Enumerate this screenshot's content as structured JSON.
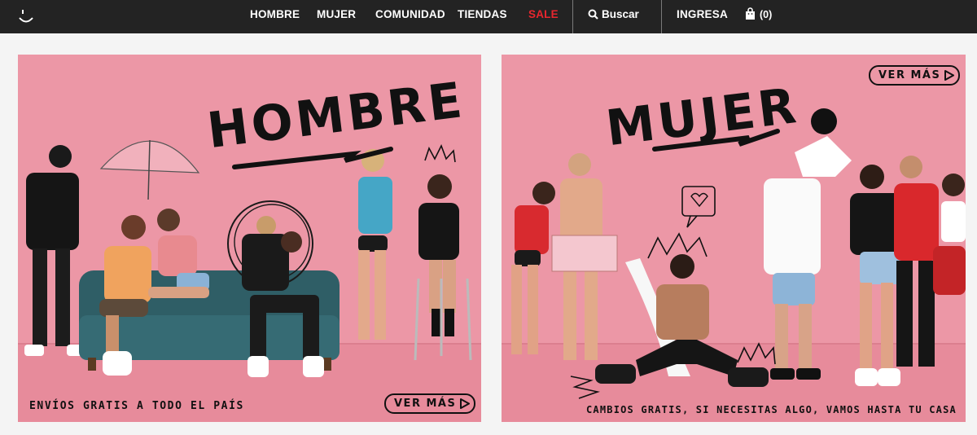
{
  "header": {
    "logo_icon": "smile-logo-icon",
    "nav": [
      {
        "label": "HOMBRE"
      },
      {
        "label": "MUJER"
      },
      {
        "label": "COMUNIDAD"
      },
      {
        "label": "TIENDAS"
      },
      {
        "label": "SALE",
        "color": "#e8262e"
      }
    ],
    "search": {
      "label": "Buscar",
      "icon": "search-icon"
    },
    "login_label": "INGRESA",
    "cart": {
      "label": "(0)",
      "icon": "shopping-bag-icon"
    }
  },
  "banners": {
    "men": {
      "title": "HOMBRE",
      "cta": "VER MÁS",
      "footnote": "ENVÍOS GRATIS A TODO EL PAÍS"
    },
    "women": {
      "title": "MUJER",
      "cta": "VER MÁS",
      "footnote": "CAMBIOS GRATIS, SI NECESITAS ALGO, VAMOS HASTA TU CASA"
    }
  },
  "colors": {
    "topbar": "#232323",
    "banner_pink": "#ec97a6",
    "sale_red": "#e8262e"
  }
}
